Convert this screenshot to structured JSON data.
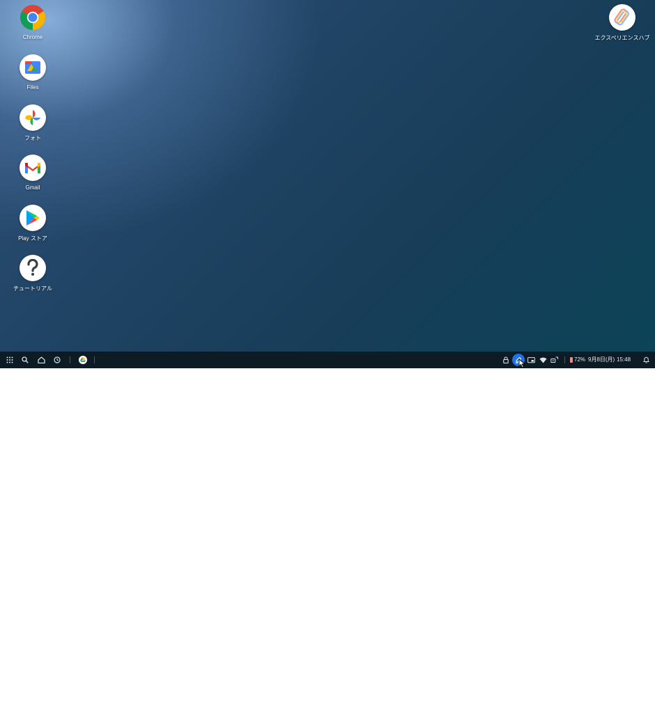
{
  "desktop": {
    "apps": [
      {
        "label": "Chrome",
        "icon": "chrome-icon"
      },
      {
        "label": "Files",
        "icon": "files-icon"
      },
      {
        "label": "フォト",
        "icon": "photos-icon"
      },
      {
        "label": "Gmail",
        "icon": "gmail-icon"
      },
      {
        "label": "Play ストア",
        "icon": "play-store-icon"
      },
      {
        "label": "チュートリアル",
        "icon": "help-icon"
      }
    ],
    "right_app": {
      "label": "エクスペリエンスハブ",
      "icon": "experience-hub-icon"
    }
  },
  "shelf": {
    "launcher_icon": "launcher-icon",
    "search_icon": "search-icon",
    "home_icon": "home-icon",
    "recent_icon": "recent-icon",
    "pinned_app_icon": "google-drive-icon",
    "tray": {
      "lock_icon": "lock-icon",
      "active_icon": "stylus-icon",
      "screen_icon": "cast-icon",
      "wifi_icon": "wifi-icon",
      "vpn_icon": "vpn-icon",
      "battery": "72%",
      "date": "9月8日(月)",
      "time": "15:48",
      "notification_icon": "notification-bell-icon"
    }
  },
  "colors": {
    "accent": "#1a73e8",
    "shelf": "#0d1b25"
  }
}
